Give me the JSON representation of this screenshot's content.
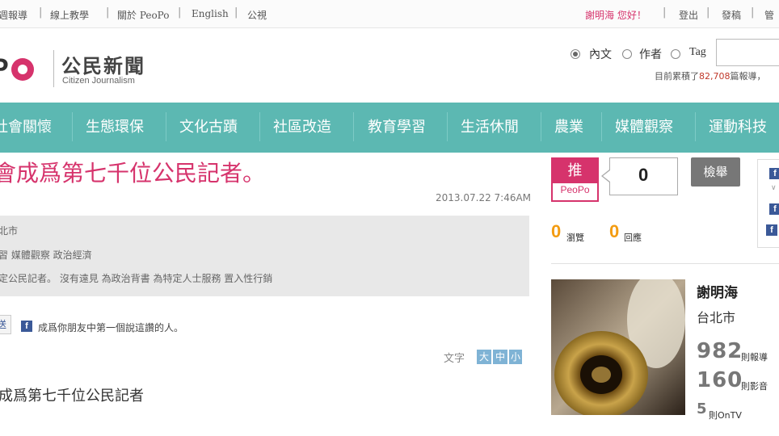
{
  "topbar": {
    "links": [
      "週報導",
      "線上教學",
      "關於 PeoPo",
      "English",
      "公視"
    ],
    "greeting": "謝明海 您好！",
    "logout": "登出",
    "post": "發稿",
    "manage": "管"
  },
  "header": {
    "logo_title": "公民新聞",
    "logo_subtitle": "Citizen Journalism",
    "search": {
      "options": [
        "內文",
        "作者",
        "Tag"
      ],
      "selected": "內文",
      "placeholder": ""
    },
    "report_count_prefix": "目前累積了",
    "report_count": "82,708",
    "report_count_suffix": "篇報導，"
  },
  "nav": {
    "items": [
      "社會關懷",
      "生態環保",
      "文化古蹟",
      "社區改造",
      "教育學習",
      "生活休閒",
      "農業",
      "媒體觀察",
      "運動科技"
    ]
  },
  "article": {
    "title": "會成爲第七千位公民記者。",
    "date": "2013.07.22 7:46AM",
    "location": "北市",
    "categories": "習   媒體觀察   政治經濟",
    "tags": "定公民記者。   沒有遠見   為政治背書   為特定人士服務   置入性行銷",
    "share_label": "送",
    "fb_text": "成爲你朋友中第一個說這讚的人。",
    "text_size_label": "文字",
    "text_sizes": [
      "大",
      "中",
      "小"
    ],
    "body_first_line": "成爲第七千位公民記者"
  },
  "sidebar": {
    "push_label": "推",
    "push_brand": "PeoPo",
    "vote_count": "0",
    "report_button": "檢舉",
    "views_count": "0",
    "views_label": "瀏覽",
    "replies_count": "0",
    "replies_label": "回應",
    "author": {
      "name": "謝明海",
      "city": "台北市",
      "reports_count": "982",
      "reports_label": "則報導",
      "media_count": "160",
      "media_label": "則影音",
      "ontv_count": "5",
      "ontv_label": "則OnTV"
    }
  },
  "colors": {
    "accent_pink": "#d6336c",
    "nav_teal": "#5cb8b2",
    "stat_orange": "#f39c12"
  }
}
